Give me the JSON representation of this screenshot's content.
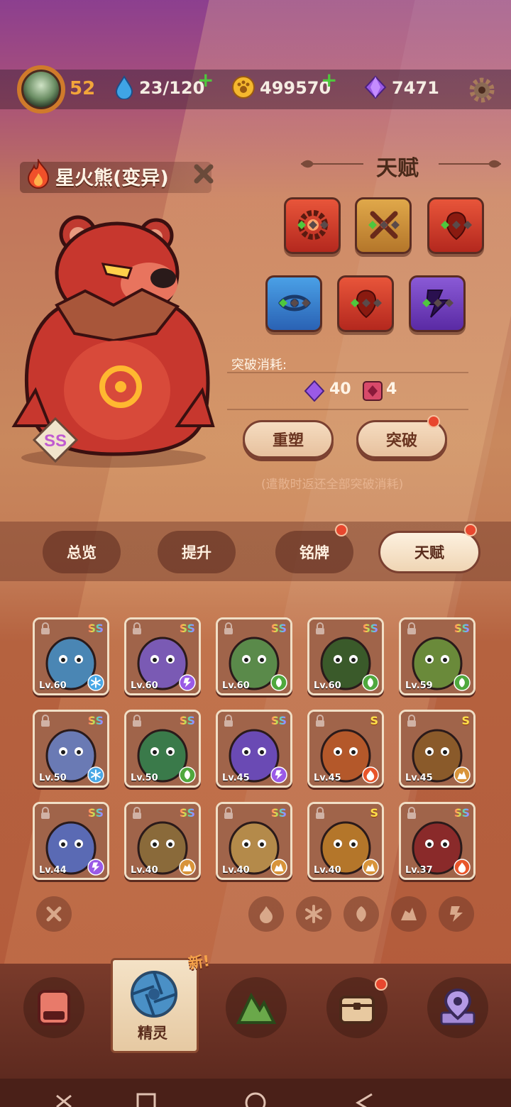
{
  "player": {
    "level": "52"
  },
  "resources": {
    "stamina": "23/120",
    "coins": "499570",
    "gems": "7471"
  },
  "monster": {
    "name": "星火熊(变异)",
    "rank": "SS"
  },
  "talent": {
    "title": "天赋",
    "breakthrough_label": "突破消耗:",
    "cost_gems": "40",
    "cost_items": "4",
    "reforge_button": "重塑",
    "breakthrough_button": "突破",
    "note": "(遣散时返还全部突破消耗)"
  },
  "tabs": [
    "总览",
    "提升",
    "铭牌",
    "天赋"
  ],
  "roster": [
    {
      "level": "Lv.60",
      "rank": "SS",
      "element": "ice-icon"
    },
    {
      "level": "Lv.60",
      "rank": "SS",
      "element": "lightning-icon"
    },
    {
      "level": "Lv.60",
      "rank": "SS",
      "element": "leaf-icon"
    },
    {
      "level": "Lv.60",
      "rank": "SS",
      "element": "leaf-icon"
    },
    {
      "level": "Lv.59",
      "rank": "SS",
      "element": "leaf-icon"
    },
    {
      "level": "Lv.50",
      "rank": "SS",
      "element": "ice-icon"
    },
    {
      "level": "Lv.50",
      "rank": "SS",
      "element": "leaf-icon"
    },
    {
      "level": "Lv.45",
      "rank": "SS",
      "element": "lightning-icon"
    },
    {
      "level": "Lv.45",
      "rank": "S",
      "element": "fire-icon"
    },
    {
      "level": "Lv.45",
      "rank": "S",
      "element": "rock-icon"
    },
    {
      "level": "Lv.44",
      "rank": "SS",
      "element": "lightning-icon"
    },
    {
      "level": "Lv.40",
      "rank": "SS",
      "element": "rock-icon"
    },
    {
      "level": "Lv.40",
      "rank": "SS",
      "element": "rock-icon"
    },
    {
      "level": "Lv.40",
      "rank": "S",
      "element": "rock-icon"
    },
    {
      "level": "Lv.37",
      "rank": "SS",
      "element": "fire-icon"
    }
  ],
  "nav": {
    "active_label": "精灵",
    "new_tag": "新!"
  },
  "colors": {
    "accent_orange": "#d07a2b",
    "plus_green": "#4fc73d",
    "notification_red": "#e8472e"
  }
}
